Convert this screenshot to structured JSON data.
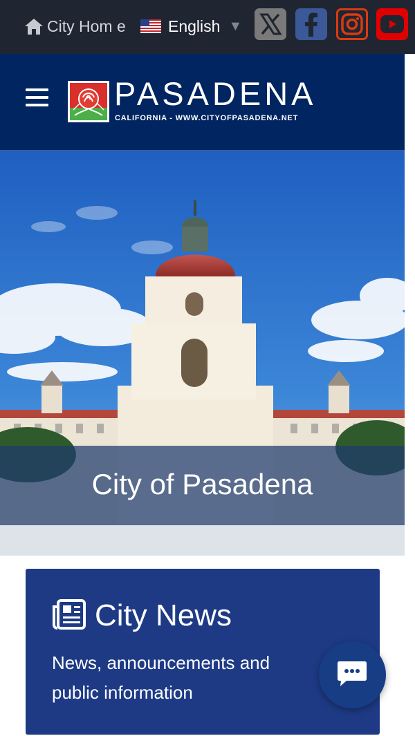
{
  "topbar": {
    "home_label": "City Hom e",
    "language": "English",
    "social": [
      {
        "name": "x-icon"
      },
      {
        "name": "facebook-icon"
      },
      {
        "name": "instagram-icon"
      },
      {
        "name": "youtube-icon"
      }
    ]
  },
  "header": {
    "brand_name": "PASADENA",
    "brand_subtitle": "CALIFORNIA - WWW.CITYOFPASADENA.NET"
  },
  "hero": {
    "title": "City of Pasadena"
  },
  "news_card": {
    "title": "City News",
    "description": "News, announcements and public information"
  },
  "colors": {
    "topbar_bg": "#1f2531",
    "header_bg": "#002560",
    "card_bg": "#1e3a85",
    "chat_bg": "#173d85",
    "facebook": "#3b5998",
    "youtube": "#e00000",
    "instagram": "#d93b12"
  }
}
